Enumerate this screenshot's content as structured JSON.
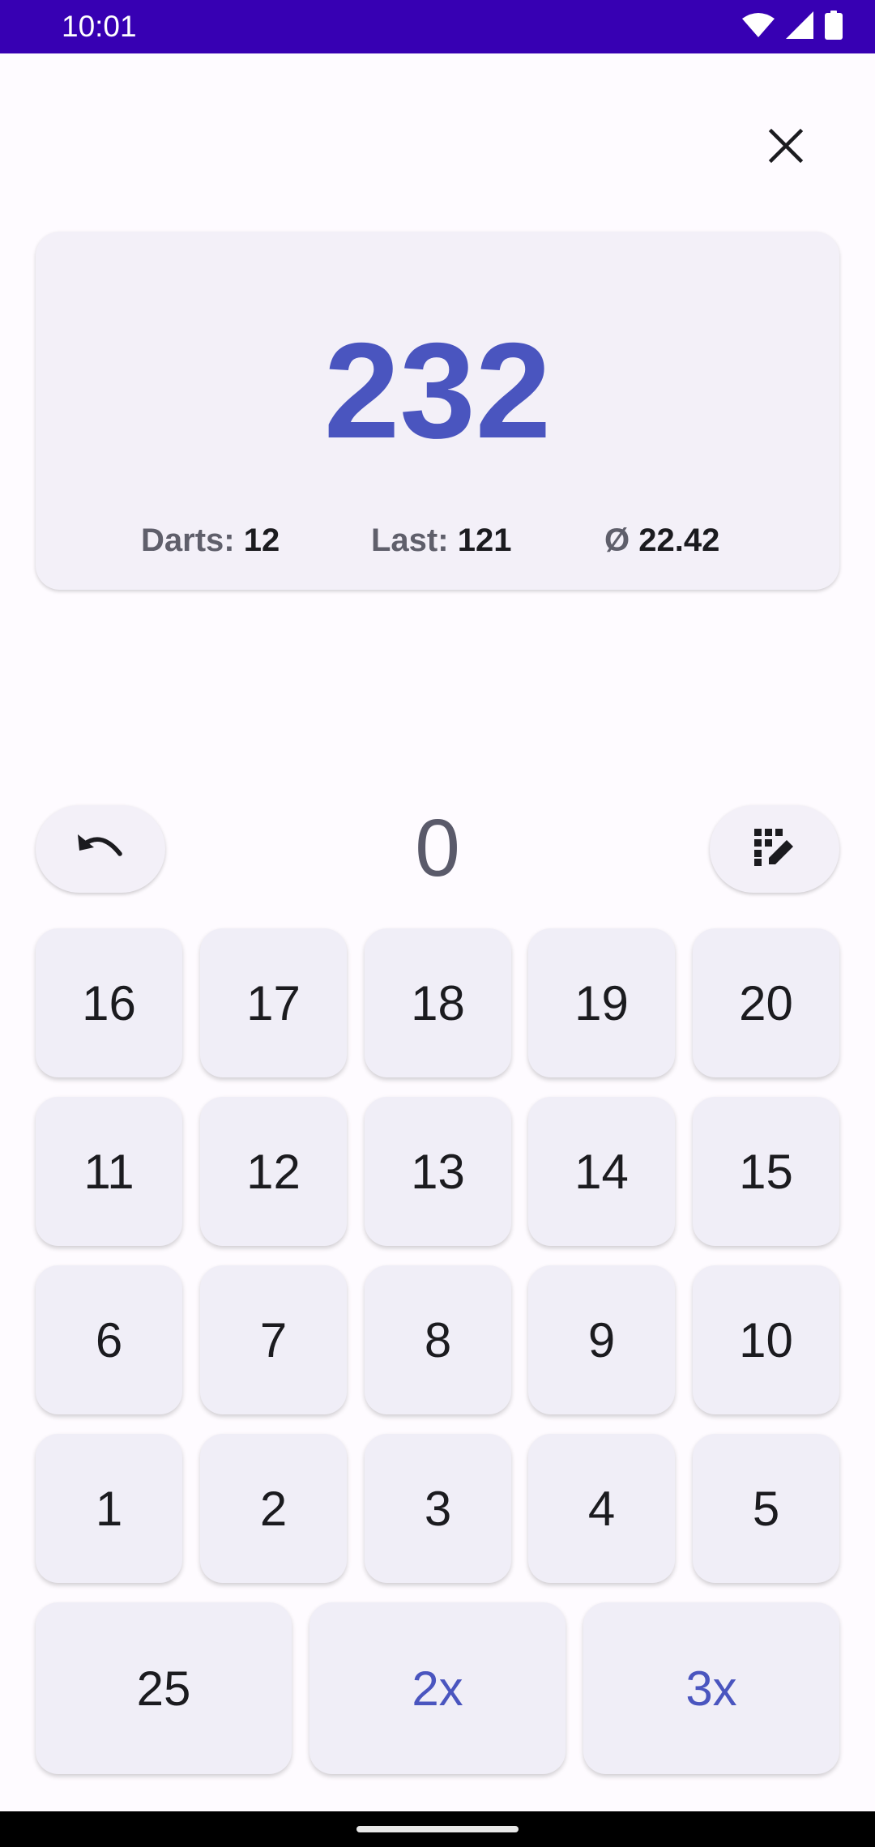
{
  "status_bar": {
    "time": "10:01",
    "icons": [
      "wifi-icon",
      "signal-icon",
      "battery-icon"
    ]
  },
  "header": {
    "close_icon": "close-icon"
  },
  "score": {
    "remaining": "232",
    "darts_label": "Darts:",
    "darts_value": "12",
    "last_label": "Last:",
    "last_value": "121",
    "avg_symbol": "Ø",
    "avg_value": "22.42"
  },
  "input": {
    "undo_icon": "undo-icon",
    "current_value": "0",
    "keypad_icon": "dialpad-edit-icon"
  },
  "keypad": {
    "rows": [
      [
        "16",
        "17",
        "18",
        "19",
        "20"
      ],
      [
        "11",
        "12",
        "13",
        "14",
        "15"
      ],
      [
        "6",
        "7",
        "8",
        "9",
        "10"
      ],
      [
        "1",
        "2",
        "3",
        "4",
        "5"
      ]
    ],
    "bottom": [
      "25",
      "2x",
      "3x"
    ]
  },
  "colors": {
    "status_bar": "#3700b3",
    "accent": "#4a55bf",
    "card_bg": "#f3f0f8",
    "page_bg": "#fefbff"
  }
}
